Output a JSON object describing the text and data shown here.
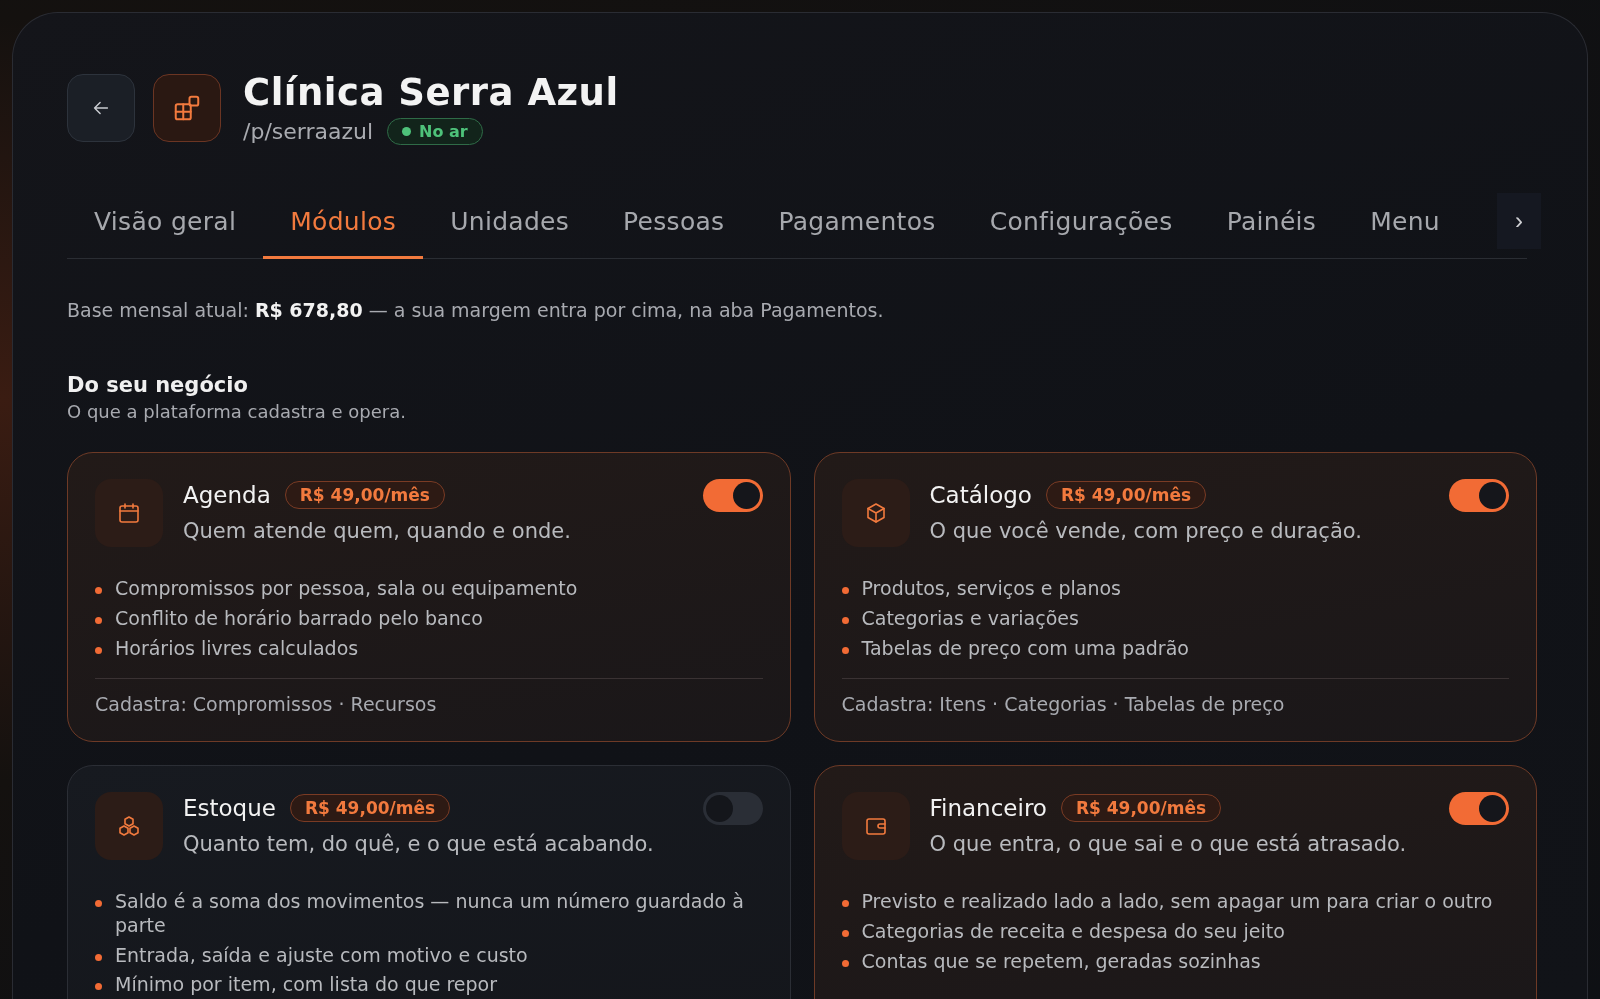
{
  "header": {
    "title": "Clínica Serra Azul",
    "path": "/p/serraazul",
    "status": {
      "label": "No ar",
      "live": true
    }
  },
  "tabs": [
    {
      "label": "Visão geral",
      "selected": false
    },
    {
      "label": "Módulos",
      "selected": true
    },
    {
      "label": "Unidades",
      "selected": false
    },
    {
      "label": "Pessoas",
      "selected": false
    },
    {
      "label": "Pagamentos",
      "selected": false
    },
    {
      "label": "Configurações",
      "selected": false
    },
    {
      "label": "Painéis",
      "selected": false
    },
    {
      "label": "Menu",
      "selected": false
    }
  ],
  "tabs_scroll": "›",
  "base_note": "Base mensal atual: **R$ 678,80** — a sua margem entra por cima, na aba Pagamentos.",
  "section": {
    "title": "Do seu negócio",
    "subtitle": "O que a plataforma cadastra e opera."
  },
  "modules": [
    {
      "name": "Agenda",
      "price": "R$ 49,00/mês",
      "on": true,
      "description": "Quem atende quem, quando e onde.",
      "features": [
        "Compromissos por pessoa, sala ou equipamento",
        "Conflito de horário barrado pelo banco",
        "Horários livres calculados"
      ],
      "registers": "Cadastra: Compromissos · Recursos"
    },
    {
      "name": "Catálogo",
      "price": "R$ 49,00/mês",
      "on": true,
      "description": "O que você vende, com preço e duração.",
      "features": [
        "Produtos, serviços e planos",
        "Categorias e variações",
        "Tabelas de preço com uma padrão"
      ],
      "registers": "Cadastra: Itens · Categorias · Tabelas de preço"
    },
    {
      "name": "Estoque",
      "price": "R$ 49,00/mês",
      "on": false,
      "description": "Quanto tem, do quê, e o que está acabando.",
      "features": [
        "Saldo é a soma dos movimentos — nunca um número guardado à parte",
        "Entrada, saída e ajuste com motivo e custo",
        "Mínimo por item, com lista do que repor"
      ]
    },
    {
      "name": "Financeiro",
      "price": "R$ 49,00/mês",
      "on": true,
      "description": "O que entra, o que sai e o que está atrasado.",
      "features": [
        "Previsto e realizado lado a lado, sem apagar um para criar o outro",
        "Categorias de receita e despesa do seu jeito",
        "Contas que se repetem, geradas sozinhas"
      ]
    }
  ]
}
